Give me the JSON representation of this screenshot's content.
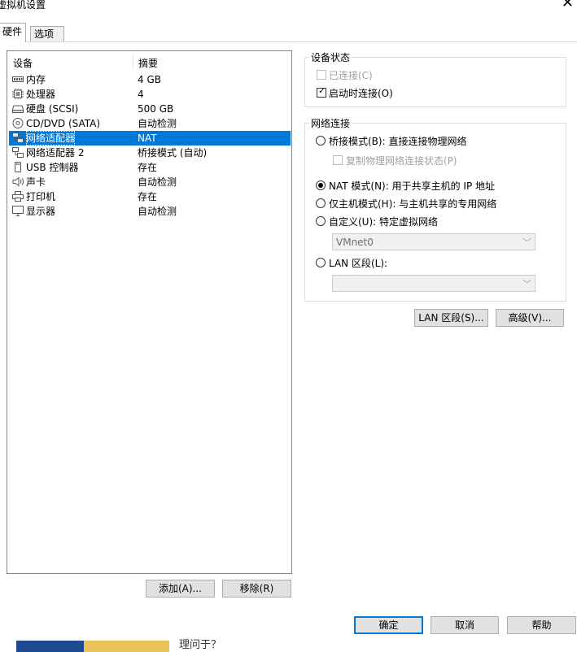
{
  "window": {
    "title": "虚拟机设置",
    "close_glyph": "✕"
  },
  "tabs": [
    {
      "label": "硬件"
    },
    {
      "label": "选项"
    }
  ],
  "device_list": {
    "col_device": "设备",
    "col_summary": "摘要",
    "rows": [
      {
        "name": "内存",
        "summary": "4 GB",
        "icon": "memory-icon"
      },
      {
        "name": "处理器",
        "summary": "4",
        "icon": "processor-icon"
      },
      {
        "name": "硬盘 (SCSI)",
        "summary": "500 GB",
        "icon": "hard-disk-icon"
      },
      {
        "name": "CD/DVD (SATA)",
        "summary": "自动检测",
        "icon": "cd-dvd-icon"
      },
      {
        "name": "网络适配器",
        "summary": "NAT",
        "icon": "network-adapter-icon",
        "selected": true
      },
      {
        "name": "网络适配器 2",
        "summary": "桥接模式 (自动)",
        "icon": "network-adapter-icon"
      },
      {
        "name": "USB 控制器",
        "summary": "存在",
        "icon": "usb-icon"
      },
      {
        "name": "声卡",
        "summary": "自动检测",
        "icon": "sound-card-icon"
      },
      {
        "name": "打印机",
        "summary": "存在",
        "icon": "printer-icon"
      },
      {
        "name": "显示器",
        "summary": "自动检测",
        "icon": "display-icon"
      }
    ]
  },
  "list_buttons": {
    "add": "添加(A)...",
    "remove": "移除(R)"
  },
  "device_status": {
    "title": "设备状态",
    "connected": {
      "label": "已连接(C)",
      "checked": false,
      "disabled": true
    },
    "connect_on_power": {
      "label": "启动时连接(O)",
      "checked": true
    }
  },
  "network": {
    "title": "网络连接",
    "bridged": {
      "label": "桥接模式(B): 直接连接物理网络",
      "selected": false
    },
    "replicate": {
      "label": "复制物理网络连接状态(P)",
      "checked": false,
      "disabled": true
    },
    "nat": {
      "label": "NAT 模式(N): 用于共享主机的 IP 地址",
      "selected": true
    },
    "host_only": {
      "label": "仅主机模式(H): 与主机共享的专用网络",
      "selected": false
    },
    "custom": {
      "label": "自定义(U): 特定虚拟网络",
      "selected": false,
      "select_value": "VMnet0"
    },
    "lan_segment": {
      "label": "LAN 区段(L):",
      "selected": false,
      "select_value": ""
    }
  },
  "panel_buttons": {
    "lan_segments": "LAN 区段(S)...",
    "advanced": "高级(V)..."
  },
  "dialog_buttons": {
    "ok": "确定",
    "cancel": "取消",
    "help": "帮助"
  },
  "background_strip": {
    "text": "理问于？"
  }
}
